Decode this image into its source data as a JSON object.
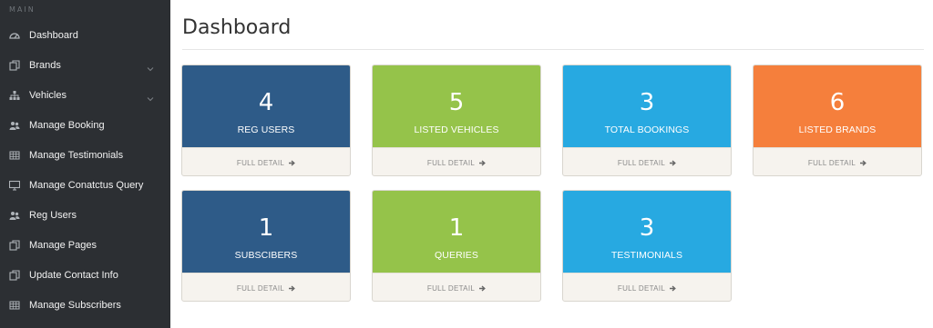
{
  "sidebar": {
    "section": "MAIN",
    "items": [
      {
        "label": "Dashboard",
        "icon": "dashboard-icon"
      },
      {
        "label": "Brands",
        "icon": "copy-icon",
        "has_submenu": true
      },
      {
        "label": "Vehicles",
        "icon": "sitemap-icon",
        "has_submenu": true
      },
      {
        "label": "Manage Booking",
        "icon": "users-icon"
      },
      {
        "label": "Manage Testimonials",
        "icon": "table-icon"
      },
      {
        "label": "Manage Conatctus Query",
        "icon": "desktop-icon"
      },
      {
        "label": "Reg Users",
        "icon": "users-icon"
      },
      {
        "label": "Manage Pages",
        "icon": "copy-icon"
      },
      {
        "label": "Update Contact Info",
        "icon": "copy-icon"
      },
      {
        "label": "Manage Subscribers",
        "icon": "table-icon"
      }
    ]
  },
  "main": {
    "title": "Dashboard",
    "cards": [
      {
        "value": "4",
        "label": "REG USERS",
        "footer": "FULL DETAIL",
        "color": "#2e5b88"
      },
      {
        "value": "5",
        "label": "LISTED VEHICLES",
        "footer": "FULL DETAIL",
        "color": "#95c34a"
      },
      {
        "value": "3",
        "label": "TOTAL BOOKINGS",
        "footer": "FULL DETAIL",
        "color": "#27a9e1"
      },
      {
        "value": "6",
        "label": "LISTED BRANDS",
        "footer": "FULL DETAIL",
        "color": "#f57f3c"
      },
      {
        "value": "1",
        "label": "SUBSCIBERS",
        "footer": "FULL DETAIL",
        "color": "#2e5b88"
      },
      {
        "value": "1",
        "label": "QUERIES",
        "footer": "FULL DETAIL",
        "color": "#95c34a"
      },
      {
        "value": "3",
        "label": "TESTIMONIALS",
        "footer": "FULL DETAIL",
        "color": "#27a9e1"
      }
    ]
  },
  "colors": {
    "sidebar_bg": "#2c2f33",
    "card_footer_bg": "#f6f3ee"
  }
}
